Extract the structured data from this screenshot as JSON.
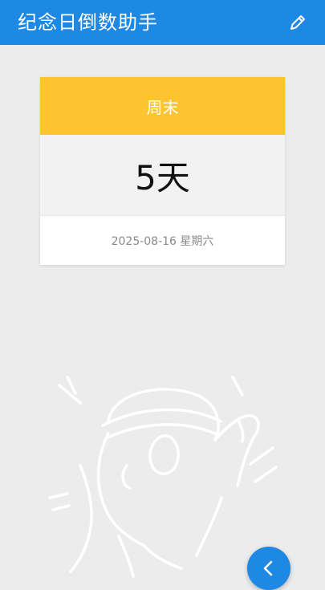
{
  "app_bar": {
    "title": "纪念日倒数助手",
    "edit_icon": "pencil-icon",
    "background": "#1e88e5"
  },
  "event_card": {
    "name": "周末",
    "count": "5天",
    "date": "2025-08-16 星期六",
    "header_color": "#fdc431"
  },
  "fab": {
    "icon": "chevron-left-icon",
    "color": "#1e88e5"
  }
}
